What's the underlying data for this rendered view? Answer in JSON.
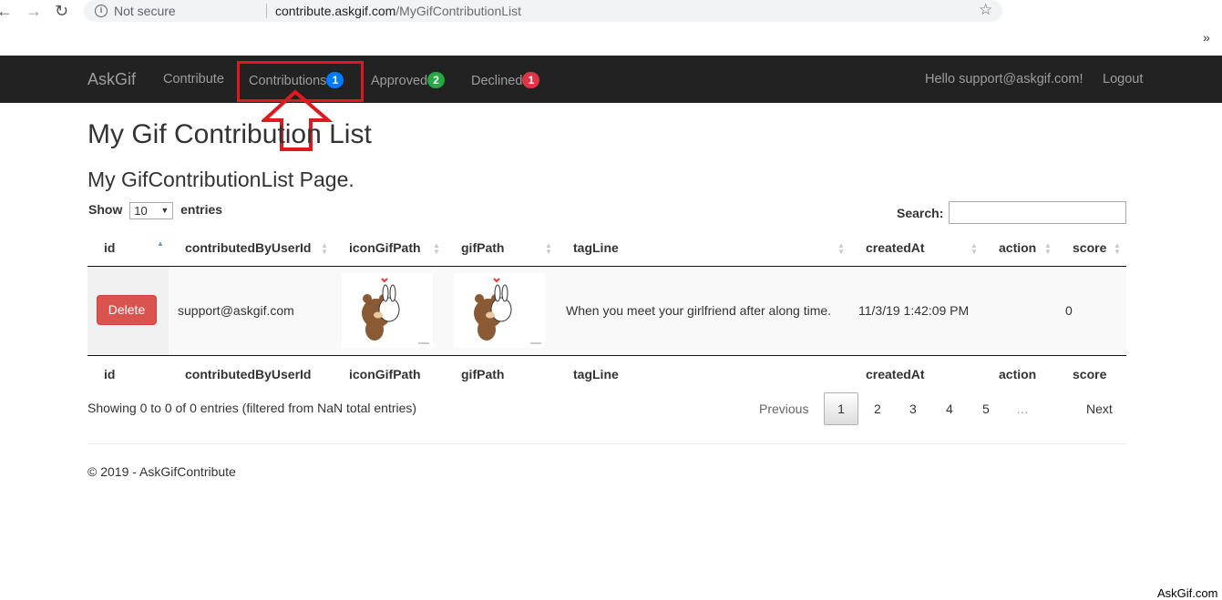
{
  "browser": {
    "secure_label": "Not secure",
    "url_host": "contribute.askgif.com",
    "url_path": "/MyGifContributionList",
    "more_label": "»"
  },
  "navbar": {
    "brand": "AskGif",
    "links": [
      {
        "label": "Contribute"
      },
      {
        "label": "Contributions",
        "badge": "1",
        "badge_color": "#007bff"
      },
      {
        "label": "Approved",
        "badge": "2",
        "badge_color": "#28a745"
      },
      {
        "label": "Declined",
        "badge": "1",
        "badge_color": "#dc3545"
      }
    ],
    "greeting": "Hello support@askgif.com!",
    "logout": "Logout",
    "highlight_color": "#e0181f"
  },
  "page": {
    "title": "My Gif Contribution List",
    "subtitle": "My GifContributionList Page."
  },
  "table_controls": {
    "show_label": "Show",
    "length_value": "10",
    "entries_label": "entries",
    "search_label": "Search:",
    "search_value": ""
  },
  "table": {
    "columns": [
      "id",
      "contributedByUserId",
      "iconGifPath",
      "gifPath",
      "tagLine",
      "createdAt",
      "action",
      "score"
    ],
    "rows": [
      {
        "action_button": "Delete",
        "contributedByUserId": "support@askgif.com",
        "iconGifPath": "bear-and-bunny-hug-gif",
        "gifPath": "bear-and-bunny-hug-gif",
        "tagLine": "When you meet your girlfriend after along time.",
        "createdAt": "11/3/19 1:42:09 PM",
        "action": "",
        "score": "0"
      }
    ]
  },
  "pagination": {
    "info": "Showing 0 to 0 of 0 entries (filtered from NaN total entries)",
    "previous": "Previous",
    "pages": [
      "1",
      "2",
      "3",
      "4",
      "5"
    ],
    "ellipsis": "…",
    "next": "Next",
    "current": "1"
  },
  "footer": {
    "copyright": "© 2019 - AskGifContribute"
  },
  "watermark": "AskGif.com"
}
